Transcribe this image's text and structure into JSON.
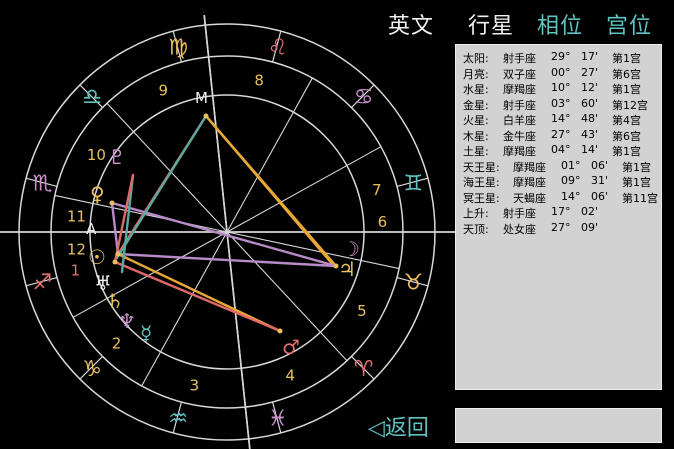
{
  "tabs": [
    {
      "label": "英文",
      "color": "#f0f0f0"
    },
    {
      "label": "行星",
      "color": "#f0f0f0"
    },
    {
      "label": "相位",
      "color": "#5fc3c2"
    },
    {
      "label": "宫位",
      "color": "#5fc3c2"
    }
  ],
  "planet_table": [
    {
      "name": "太阳:",
      "sign": "射手座",
      "degree": "29°",
      "minute": "17'",
      "house": "第1宫"
    },
    {
      "name": "月亮:",
      "sign": "双子座",
      "degree": "00°",
      "minute": "27'",
      "house": "第6宫"
    },
    {
      "name": "水星:",
      "sign": "摩羯座",
      "degree": "10°",
      "minute": "12'",
      "house": "第1宫"
    },
    {
      "name": "金星:",
      "sign": "射手座",
      "degree": "03°",
      "minute": "60'",
      "house": "第12宫"
    },
    {
      "name": "火星:",
      "sign": "白羊座",
      "degree": "14°",
      "minute": "48'",
      "house": "第4宫"
    },
    {
      "name": "木星:",
      "sign": "金牛座",
      "degree": "27°",
      "minute": "43'",
      "house": "第6宫"
    },
    {
      "name": "土星:",
      "sign": "摩羯座",
      "degree": "04°",
      "minute": "14'",
      "house": "第1宫"
    },
    {
      "name": "天王星:",
      "sign": "摩羯座",
      "degree": "01°",
      "minute": "06'",
      "house": "第1宫"
    },
    {
      "name": "海王星:",
      "sign": "摩羯座",
      "degree": "09°",
      "minute": "31'",
      "house": "第1宫"
    },
    {
      "name": "冥王星:",
      "sign": "天蝎座",
      "degree": "14°",
      "minute": "06'",
      "house": "第11宫"
    },
    {
      "name": "上升:",
      "sign": "射手座",
      "degree": "17°",
      "minute": "02'",
      "house": ""
    },
    {
      "name": "天顶:",
      "sign": "处女座",
      "degree": "27°",
      "minute": "09'",
      "house": ""
    }
  ],
  "back_label": "◁返回",
  "chart": {
    "ascendant_label": "A",
    "midheaven_label": "M",
    "house_numbers": [
      "1",
      "2",
      "3",
      "4",
      "5",
      "6",
      "7",
      "8",
      "9",
      "10",
      "11",
      "12"
    ],
    "zodiac": [
      {
        "glyph": "♏",
        "color": "#c98fc9"
      },
      {
        "glyph": "♎",
        "color": "#5fc3c2"
      },
      {
        "glyph": "♍",
        "color": "#e8c060"
      },
      {
        "glyph": "♌",
        "color": "#e07070"
      },
      {
        "glyph": "♋",
        "color": "#c98fc9"
      },
      {
        "glyph": "♊",
        "color": "#5fc3c2"
      },
      {
        "glyph": "♉",
        "color": "#e8c060"
      },
      {
        "glyph": "♈",
        "color": "#e07070"
      },
      {
        "glyph": "♓",
        "color": "#c98fc9"
      },
      {
        "glyph": "♒",
        "color": "#5fc3c2"
      },
      {
        "glyph": "♑",
        "color": "#e8c060"
      },
      {
        "glyph": "♐",
        "color": "#e07070"
      }
    ],
    "planets": [
      {
        "key": "pluto",
        "glyph": "♇",
        "color": "#c98fc9"
      },
      {
        "key": "venus",
        "glyph": "♀",
        "color": "#e8c060"
      },
      {
        "key": "sun",
        "glyph": "☉",
        "color": "#e8c060"
      },
      {
        "key": "uranus",
        "glyph": "♅",
        "color": "#f0f0f0"
      },
      {
        "key": "saturn",
        "glyph": "♄",
        "color": "#e8c060"
      },
      {
        "key": "neptune",
        "glyph": "♆",
        "color": "#c98fc9"
      },
      {
        "key": "mercury",
        "glyph": "☿",
        "color": "#5fc3c2"
      },
      {
        "key": "mars",
        "glyph": "♂",
        "color": "#e07070"
      },
      {
        "key": "moon",
        "glyph": "☽",
        "color": "#c98fc9"
      },
      {
        "key": "jupiter",
        "glyph": "♃",
        "color": "#e8c060"
      }
    ],
    "aspect_colors": {
      "orange": "#e8a838",
      "red": "#e06868",
      "purple": "#b88ac8",
      "teal": "#5aa8a0"
    }
  }
}
